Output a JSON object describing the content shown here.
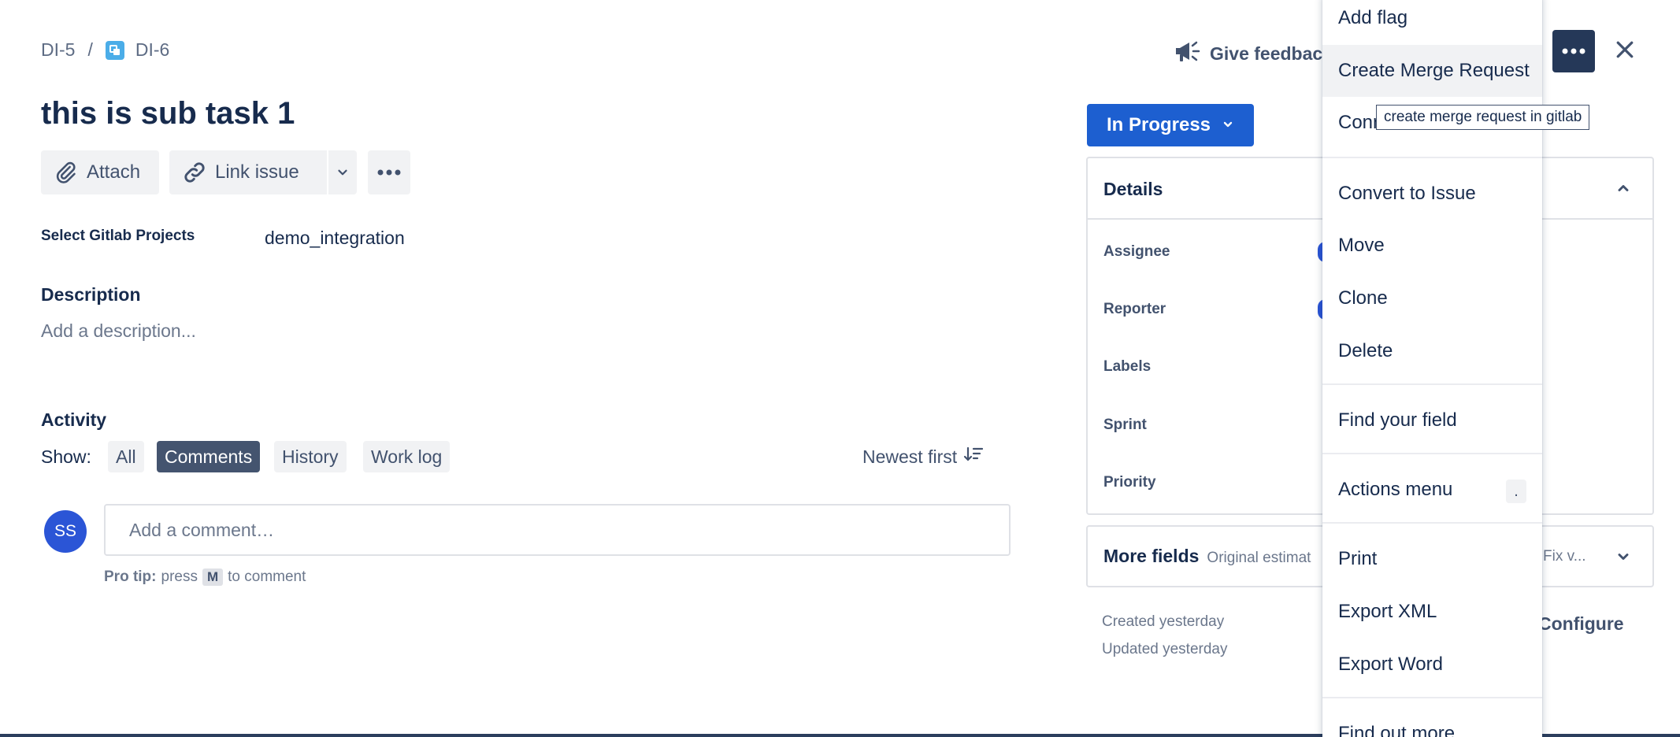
{
  "breadcrumb": {
    "parent": "DI-5",
    "separator": "/",
    "current": "DI-6"
  },
  "issue": {
    "title": "this is sub task 1"
  },
  "toolbar": {
    "attach_label": "Attach",
    "link_issue_label": "Link issue"
  },
  "fields": {
    "gitlab_label": "Select Gitlab Projects",
    "gitlab_value": "demo_integration"
  },
  "description": {
    "heading": "Description",
    "placeholder": "Add a description..."
  },
  "activity": {
    "heading": "Activity",
    "show_label": "Show:",
    "filters": [
      "All",
      "Comments",
      "History",
      "Work log"
    ],
    "active_filter": "Comments",
    "sort_label": "Newest first"
  },
  "comment": {
    "avatar_initials": "SS",
    "placeholder": "Add a comment…",
    "pro_tip_label": "Pro tip:",
    "pro_tip_text_1": "press",
    "pro_tip_key": "M",
    "pro_tip_text_2": "to comment"
  },
  "header": {
    "feedback_label": "Give feedback"
  },
  "status": {
    "label": "In Progress"
  },
  "details": {
    "heading": "Details",
    "rows": [
      "Assignee",
      "Reporter",
      "Labels",
      "Sprint",
      "Priority"
    ]
  },
  "more_fields": {
    "heading": "More fields",
    "hint_left": "Original estimat",
    "hint_right": "Fix v..."
  },
  "meta": {
    "created": "Created yesterday",
    "updated": "Updated yesterday",
    "configure_label": "Configure"
  },
  "menu": {
    "items": [
      "Add flag",
      "Create Merge Request",
      "Conn",
      "Convert to Issue",
      "Move",
      "Clone",
      "Delete",
      "Find your field",
      "Actions menu",
      "Print",
      "Export XML",
      "Export Word",
      "Find out more"
    ],
    "actions_shortcut": "."
  },
  "tooltip": {
    "text": "create merge request in gitlab"
  },
  "colors": {
    "primary": "#1d5fd0",
    "text": "#172b4d",
    "subtle": "#5e6c84",
    "active_chip": "#44546f",
    "avatar": "#2b55d6",
    "dark_button": "#253858"
  }
}
